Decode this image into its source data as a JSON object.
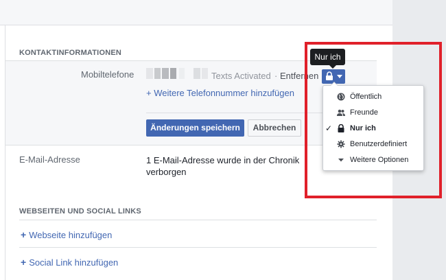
{
  "contact_section": {
    "title": "KONTAKTINFORMATIONEN",
    "mobile": {
      "label": "Mobiltelefone",
      "status": "Texts Activated",
      "separator": "·",
      "remove_link": "Entfernen",
      "add_link": "+ Weitere Telefonnummer hinzufügen"
    },
    "save_button": "Änderungen speichern",
    "cancel_button": "Abbrechen",
    "email": {
      "label": "E-Mail-Adresse",
      "value_line1": "1 E-Mail-Adresse wurde in der Chronik",
      "value_line2": "verborgen"
    }
  },
  "privacy": {
    "tooltip": "Nur ich",
    "options": [
      {
        "label": "Öffentlich",
        "icon": "globe-icon",
        "selected": false
      },
      {
        "label": "Freunde",
        "icon": "friends-icon",
        "selected": false
      },
      {
        "label": "Nur ich",
        "icon": "lock-icon",
        "selected": true
      },
      {
        "label": "Benutzerdefiniert",
        "icon": "gear-icon",
        "selected": false
      },
      {
        "label": "Weitere Optionen",
        "icon": "caret-down-icon",
        "selected": false
      }
    ]
  },
  "web_section": {
    "title": "WEBSEITEN UND SOCIAL LINKS",
    "add_website": "Webseite hinzufügen",
    "add_social": "Social Link hinzufügen"
  },
  "colors": {
    "accent": "#4267b2",
    "highlight": "#e0202a",
    "tooltip": "#1c1e21"
  }
}
